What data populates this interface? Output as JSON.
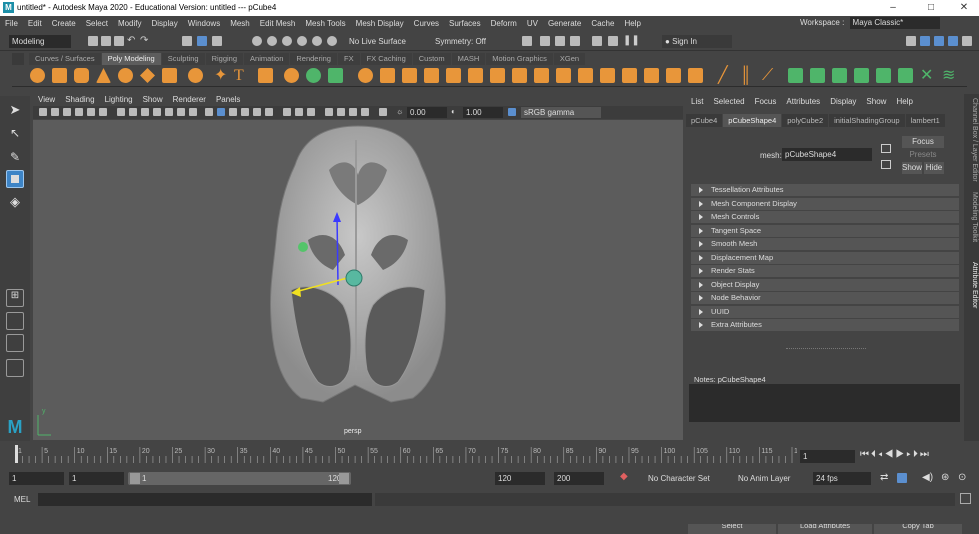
{
  "window": {
    "title": "untitled* - Autodesk Maya 2020 - Educational Version: untitled   ---   pCube4",
    "logo": "M",
    "controls": [
      "–",
      "□",
      "✕"
    ]
  },
  "menubar": {
    "items": [
      "File",
      "Edit",
      "Create",
      "Select",
      "Modify",
      "Display",
      "Windows",
      "Mesh",
      "Edit Mesh",
      "Mesh Tools",
      "Mesh Display",
      "Curves",
      "Surfaces",
      "Deform",
      "UV",
      "Generate",
      "Cache",
      "Help"
    ],
    "workspace_label": "Workspace :",
    "workspace_value": "Maya Classic*"
  },
  "statusline": {
    "menuset": "Modeling",
    "live_surface": "No Live Surface",
    "symmetry": "Symmetry: Off",
    "sign_in": "Sign In"
  },
  "shelf": {
    "tabs": [
      "Curves / Surfaces",
      "Poly Modeling",
      "Sculpting",
      "Rigging",
      "Animation",
      "Rendering",
      "FX",
      "FX Caching",
      "Custom",
      "MASH",
      "Motion Graphics",
      "XGen"
    ],
    "active_tab": "Poly Modeling"
  },
  "viewport": {
    "menu": [
      "View",
      "Shading",
      "Lighting",
      "Show",
      "Renderer",
      "Panels"
    ],
    "exposure": "0.00",
    "gamma": "1.00",
    "color_space": "sRGB gamma",
    "camera_label": "persp"
  },
  "attribute_editor": {
    "menu": [
      "List",
      "Selected",
      "Focus",
      "Attributes",
      "Display",
      "Show",
      "Help"
    ],
    "node_tabs": [
      "pCube4",
      "pCubeShape4",
      "polyCube2",
      "initialShadingGroup",
      "lambert1"
    ],
    "active_tab": "pCubeShape4",
    "mesh_label": "mesh:",
    "mesh_value": "pCubeShape4",
    "focus_button": "Focus",
    "presets_button": "Presets",
    "show_button": "Show",
    "hide_button": "Hide",
    "sections": [
      "Tessellation Attributes",
      "Mesh Component Display",
      "Mesh Controls",
      "Tangent Space",
      "Smooth Mesh",
      "Displacement Map",
      "Render Stats",
      "Object Display",
      "Node Behavior",
      "UUID",
      "Extra Attributes"
    ],
    "notes_label": "Notes:  pCubeShape4",
    "select_button": "Select",
    "load_attributes_button": "Load Attributes",
    "copy_tab_button": "Copy Tab"
  },
  "side_tabs": [
    "Channel Box / Layer Editor",
    "Modeling Toolkit",
    "Attribute Editor"
  ],
  "timeslider": {
    "ticks": [
      "1",
      "5",
      "10",
      "15",
      "20",
      "25",
      "30",
      "35",
      "40",
      "45",
      "50",
      "55",
      "60",
      "65",
      "70",
      "75",
      "80",
      "85",
      "90",
      "95",
      "100",
      "105",
      "110",
      "115",
      "120"
    ],
    "current_frame": "1"
  },
  "range": {
    "start": "1",
    "start_playback": "1",
    "range_start": "1",
    "range_end": "120",
    "end_playback": "120",
    "end": "200",
    "character_set": "No Character Set",
    "anim_layer": "No Anim Layer",
    "fps": "24 fps"
  },
  "command_line": {
    "label": "MEL"
  },
  "colors": {
    "shelf_icon": "#e8963a",
    "shelf_icon_green": "#4fb56a",
    "annotation_arrow": "#cc1111",
    "selection_highlight": "#3d84c6"
  }
}
